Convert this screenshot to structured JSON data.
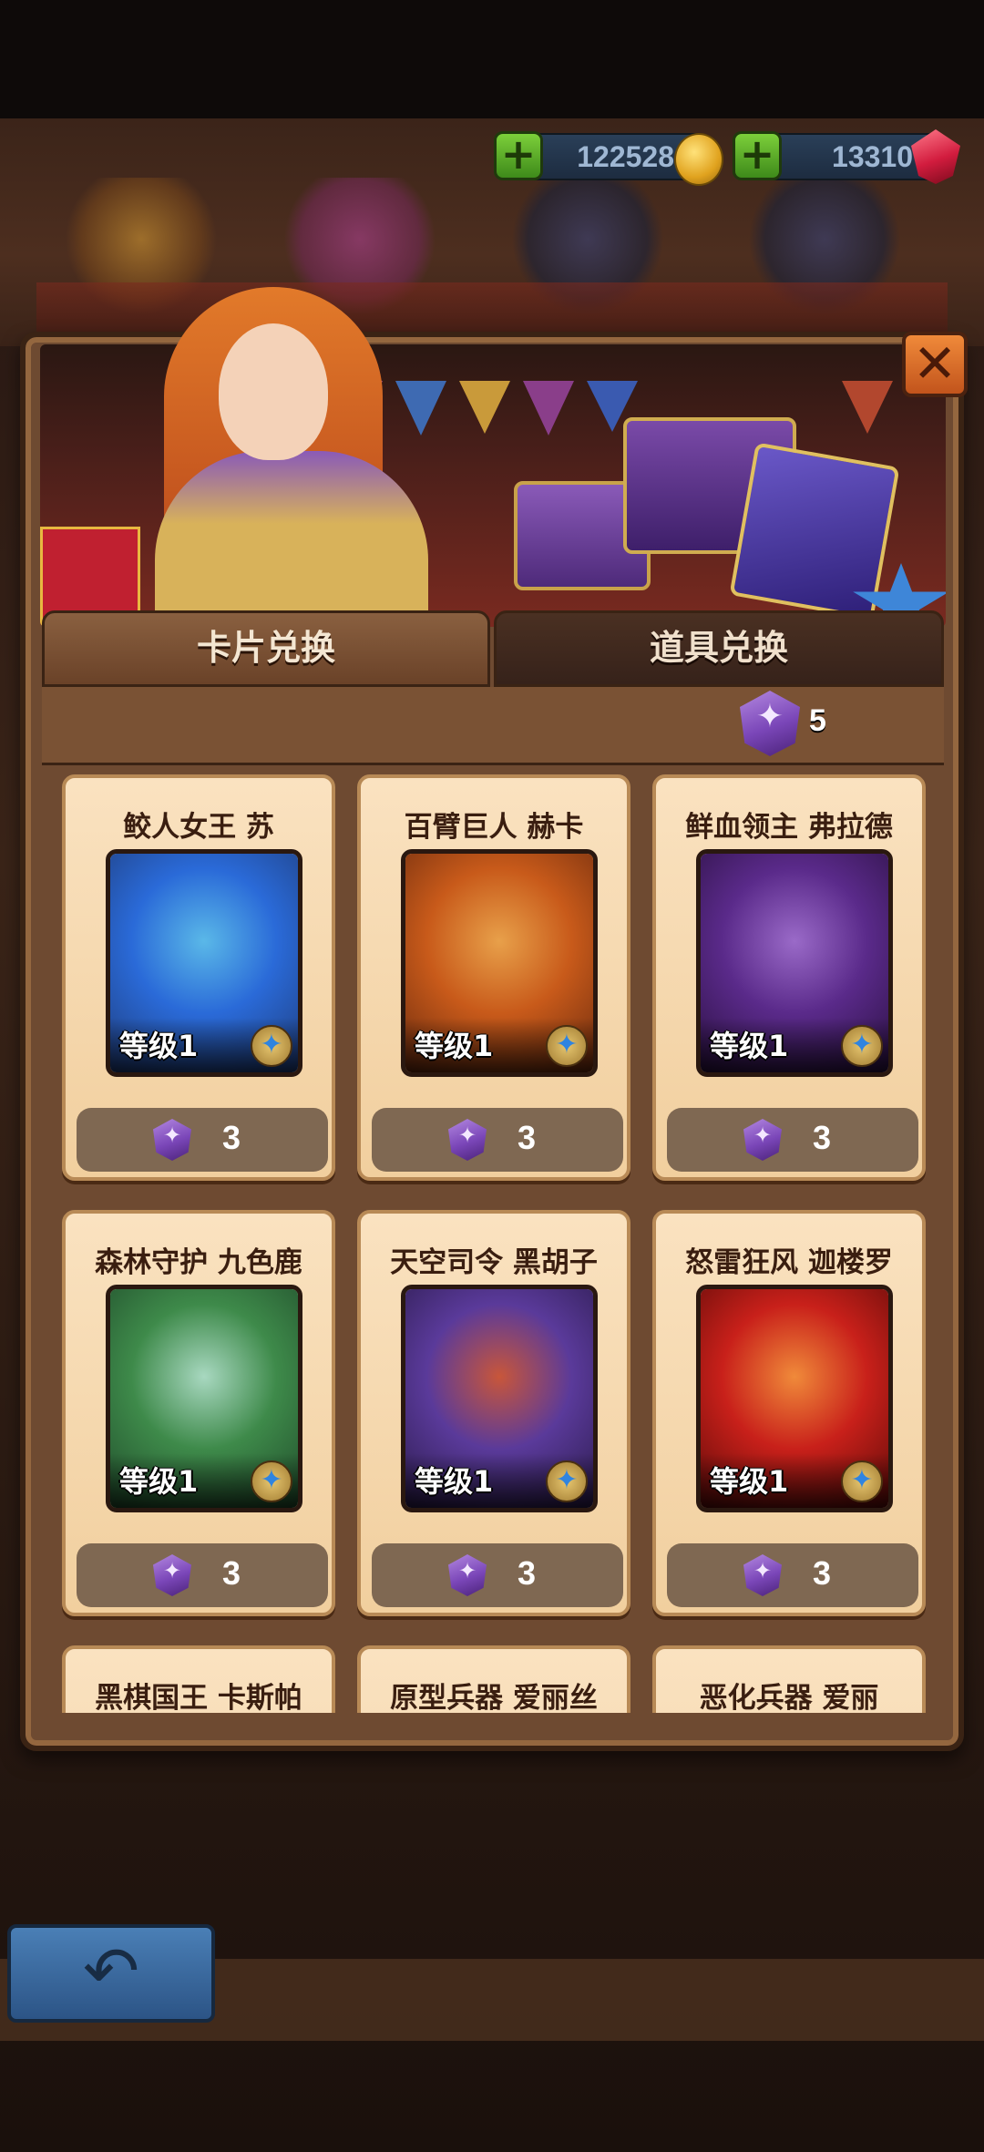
{
  "currencies": [
    {
      "name": "gold",
      "amount": "122528",
      "icon": "coin-icon"
    },
    {
      "name": "gems",
      "amount": "13310",
      "icon": "gem-icon"
    }
  ],
  "tabs": [
    {
      "label": "卡片兑换",
      "active": true
    },
    {
      "label": "道具兑换",
      "active": false
    }
  ],
  "balance": {
    "count": "5",
    "icon": "exchange-token-icon"
  },
  "cards": [
    {
      "name": "鲛人女王 苏",
      "level": "等级1",
      "price": "3",
      "colors": [
        "#2a6ad8",
        "#5ab8e8",
        "#1f3c7a"
      ]
    },
    {
      "name": "百臂巨人 赫卡",
      "level": "等级1",
      "price": "3",
      "colors": [
        "#c85a1a",
        "#e8a04a",
        "#6a2a0e"
      ]
    },
    {
      "name": "鲜血领主 弗拉德",
      "level": "等级1",
      "price": "3",
      "colors": [
        "#5a2a8a",
        "#9a6ac8",
        "#2a1040"
      ]
    },
    {
      "name": "森林守护 九色鹿",
      "level": "等级1",
      "price": "3",
      "colors": [
        "#3e8a4a",
        "#a8d8c0",
        "#1f4a2a"
      ]
    },
    {
      "name": "天空司令 黑胡子",
      "level": "等级1",
      "price": "3",
      "colors": [
        "#5a3a9a",
        "#c8563a",
        "#2a1a4a"
      ]
    },
    {
      "name": "怒雷狂风 迦楼罗",
      "level": "等级1",
      "price": "3",
      "colors": [
        "#c8201a",
        "#f08a3a",
        "#5a0a08"
      ]
    },
    {
      "name": "黑棋国王 卡斯帕",
      "level": "",
      "price": "",
      "colors": [
        "#3a3a5a",
        "#6a6a8a",
        "#1a1a2a"
      ]
    },
    {
      "name": "原型兵器 爱丽丝",
      "level": "",
      "price": "",
      "colors": [
        "#3a3a5a",
        "#6a6a8a",
        "#1a1a2a"
      ]
    },
    {
      "name": "恶化兵器 爱丽",
      "level": "",
      "price": "",
      "colors": [
        "#3a3a5a",
        "#6a6a8a",
        "#1a1a2a"
      ]
    }
  ],
  "close_button": {
    "glyph": "✕"
  },
  "back_button": {
    "glyph": "↶"
  },
  "colors": {
    "accent_orange": "#e06a24",
    "panel_brown": "#6e4a31",
    "card_cream": "#fae2c0",
    "token_purple": "#7a46b8"
  }
}
